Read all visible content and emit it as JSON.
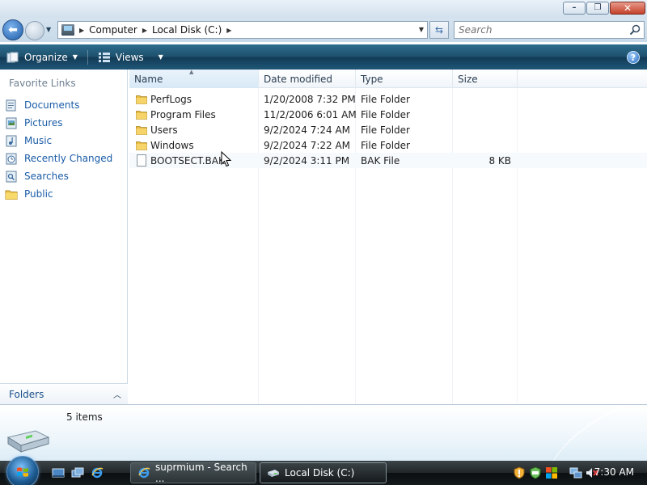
{
  "window": {
    "minimize_glyph": "–",
    "maximize_glyph": "❐",
    "close_glyph": "✕"
  },
  "address": {
    "crumbs": [
      "Computer",
      "Local Disk (C:)"
    ],
    "icon": "computer-icon"
  },
  "search": {
    "placeholder": "Search"
  },
  "toolbar": {
    "organize_label": "Organize",
    "views_label": "Views",
    "help_glyph": "?"
  },
  "nav": {
    "title": "Favorite Links",
    "items": [
      {
        "label": "Documents",
        "icon": "documents-icon"
      },
      {
        "label": "Pictures",
        "icon": "pictures-icon"
      },
      {
        "label": "Music",
        "icon": "music-icon"
      },
      {
        "label": "Recently Changed",
        "icon": "recently-changed-icon"
      },
      {
        "label": "Searches",
        "icon": "searches-icon"
      },
      {
        "label": "Public",
        "icon": "public-folder-icon"
      }
    ],
    "folders_label": "Folders"
  },
  "files": {
    "columns": [
      "Name",
      "Date modified",
      "Type",
      "Size"
    ],
    "rows": [
      {
        "name": "PerfLogs",
        "date": "1/20/2008 7:32 PM",
        "type": "File Folder",
        "size": "",
        "kind": "folder"
      },
      {
        "name": "Program Files",
        "date": "11/2/2006 6:01 AM",
        "type": "File Folder",
        "size": "",
        "kind": "folder"
      },
      {
        "name": "Users",
        "date": "9/2/2024 7:24 AM",
        "type": "File Folder",
        "size": "",
        "kind": "folder"
      },
      {
        "name": "Windows",
        "date": "9/2/2024 7:22 AM",
        "type": "File Folder",
        "size": "",
        "kind": "folder"
      },
      {
        "name": "BOOTSECT.BAK",
        "date": "9/2/2024 3:11 PM",
        "type": "BAK File",
        "size": "8 KB",
        "kind": "file"
      }
    ]
  },
  "details": {
    "item_count": "5 items"
  },
  "taskbar": {
    "buttons": [
      {
        "label": "suprmium - Search ...",
        "icon": "internet-explorer-icon"
      },
      {
        "label": "Local Disk (C:)",
        "icon": "drive-icon"
      }
    ],
    "clock": "7:30 AM"
  },
  "colors": {
    "link_blue": "#1a5ca7",
    "toolbar_dark": "#1d4f6c"
  }
}
